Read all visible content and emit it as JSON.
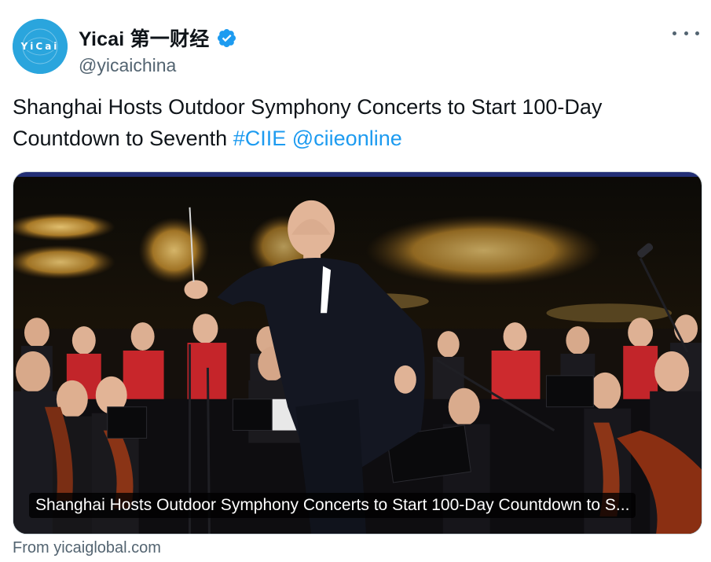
{
  "tweet": {
    "author": {
      "display_name": "Yicai 第一财经",
      "handle": "@yicaichina",
      "avatar_text": "YiCai",
      "verified": true
    },
    "text_main": "Shanghai Hosts Outdoor Symphony Concerts to Start 100-Day Countdown to Seventh ",
    "hashtag": "#CIIE",
    "mention": "@ciieonline",
    "card": {
      "caption": "Shanghai Hosts Outdoor Symphony Concerts to Start 100-Day Countdown to S...",
      "image_description_icon": "orchestra-photo"
    },
    "source_label": "From yicaiglobal.com"
  },
  "colors": {
    "link": "#1d9bf0",
    "avatar_bg": "#2aa5dd",
    "verified": "#1d9bf0",
    "muted": "#536471"
  }
}
